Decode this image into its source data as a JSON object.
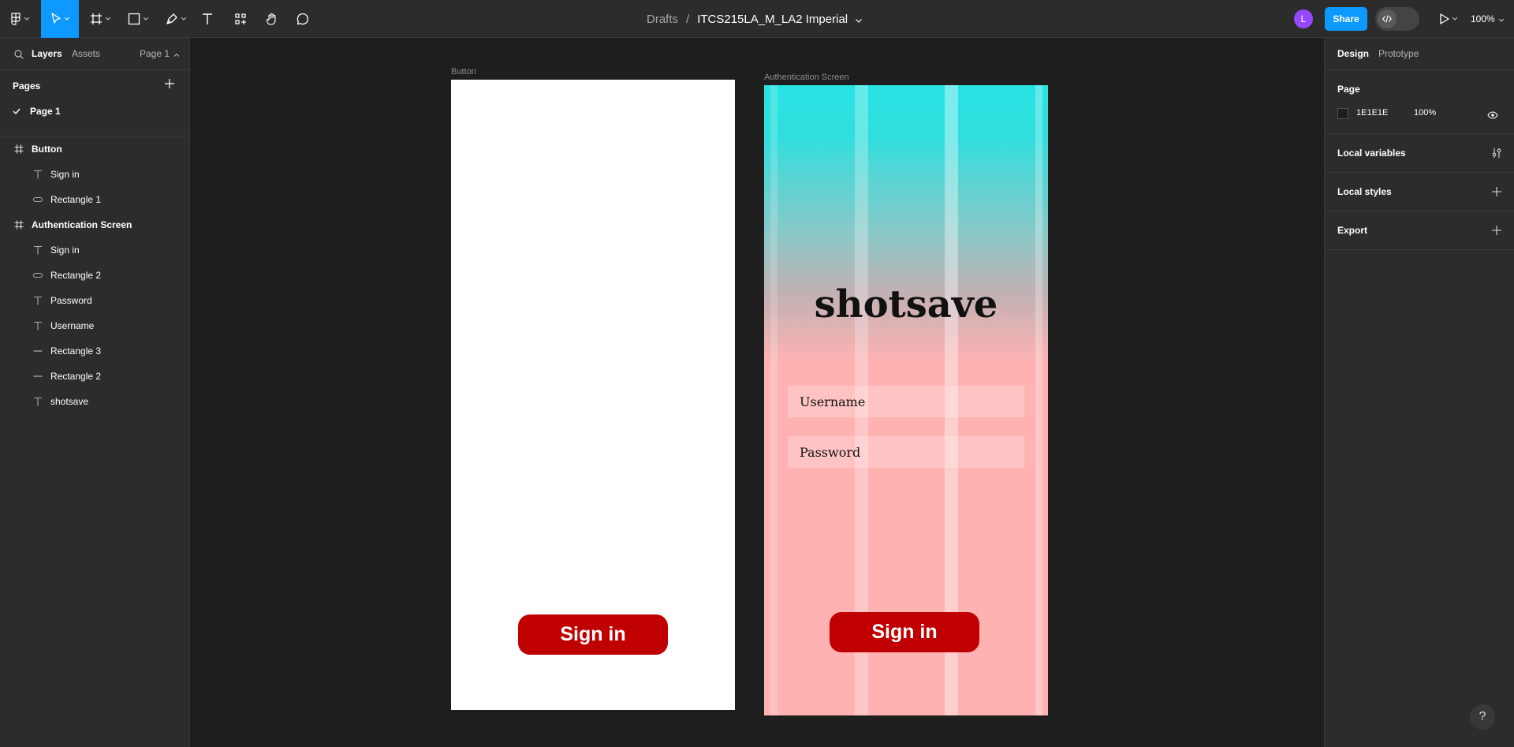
{
  "toolbar": {
    "breadcrumb_drafts": "Drafts",
    "breadcrumb_separator": "/",
    "file_name": "ITCS215LA_M_LA2 Imperial",
    "avatar_initial": "L",
    "share_label": "Share",
    "zoom_label": "100%",
    "accent_color": "#0d99ff"
  },
  "left_panel": {
    "tabs": {
      "layers": "Layers",
      "assets": "Assets",
      "page_selector": "Page 1"
    },
    "pages_title": "Pages",
    "pages": [
      {
        "label": "Page 1",
        "selected": true
      }
    ],
    "layers": [
      {
        "label": "Button",
        "type": "frame",
        "icon": "frame-icon"
      },
      {
        "label": "Sign in",
        "type": "text",
        "icon": "text-icon"
      },
      {
        "label": "Rectangle 1",
        "type": "rectangle",
        "icon": "rectangle-icon"
      },
      {
        "label": "Authentication Screen",
        "type": "frame",
        "icon": "frame-icon"
      },
      {
        "label": "Sign in",
        "type": "text",
        "icon": "text-icon"
      },
      {
        "label": "Rectangle 2",
        "type": "rectangle",
        "icon": "rectangle-icon"
      },
      {
        "label": "Password",
        "type": "text",
        "icon": "text-icon"
      },
      {
        "label": "Username",
        "type": "text",
        "icon": "text-icon"
      },
      {
        "label": "Rectangle 3",
        "type": "line",
        "icon": "line-icon"
      },
      {
        "label": "Rectangle 2",
        "type": "line",
        "icon": "line-icon"
      },
      {
        "label": "shotsave",
        "type": "text",
        "icon": "text-icon"
      }
    ]
  },
  "canvas": {
    "button_frame": {
      "label": "Button",
      "signin_text": "Sign in"
    },
    "auth_frame": {
      "label": "Authentication Screen",
      "brand": "shotsave",
      "username_placeholder": "Username",
      "password_placeholder": "Password",
      "signin_text": "Sign in"
    },
    "signin_color": "#c00000"
  },
  "right_panel": {
    "tabs": {
      "design": "Design",
      "prototype": "Prototype"
    },
    "page_section": "Page",
    "page_color": "1E1E1E",
    "page_opacity": "100%",
    "local_variables": "Local variables",
    "local_styles": "Local styles",
    "export": "Export"
  },
  "help_label": "?"
}
